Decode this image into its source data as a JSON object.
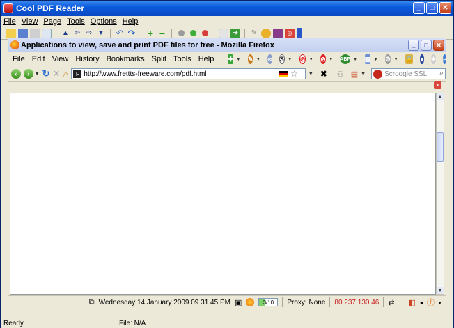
{
  "app": {
    "title": "Cool PDF Reader",
    "menu": [
      "File",
      "View",
      "Page",
      "Tools",
      "Options",
      "Help"
    ],
    "status_ready": "Ready.",
    "status_file": "File: N/A"
  },
  "firefox": {
    "title": "Applications to view, save and print PDF files for free - Mozilla Firefox",
    "menu": [
      "File",
      "Edit",
      "View",
      "History",
      "Bookmarks",
      "Split",
      "Tools",
      "Help"
    ],
    "url": "http://www.frettts-freeware.com/pdf.html",
    "search_placeholder": "Scroogle SSL",
    "status": {
      "datetime": "Wednesday 14 January 2009  09 31 45 PM",
      "progress_label": "3/10",
      "progress_value": 0.3,
      "proxy": "Proxy: None",
      "ip": "80.237.130.46"
    }
  },
  "colors": {
    "xp_blue": "#0b5bdc",
    "ip_red": "#c82222"
  }
}
